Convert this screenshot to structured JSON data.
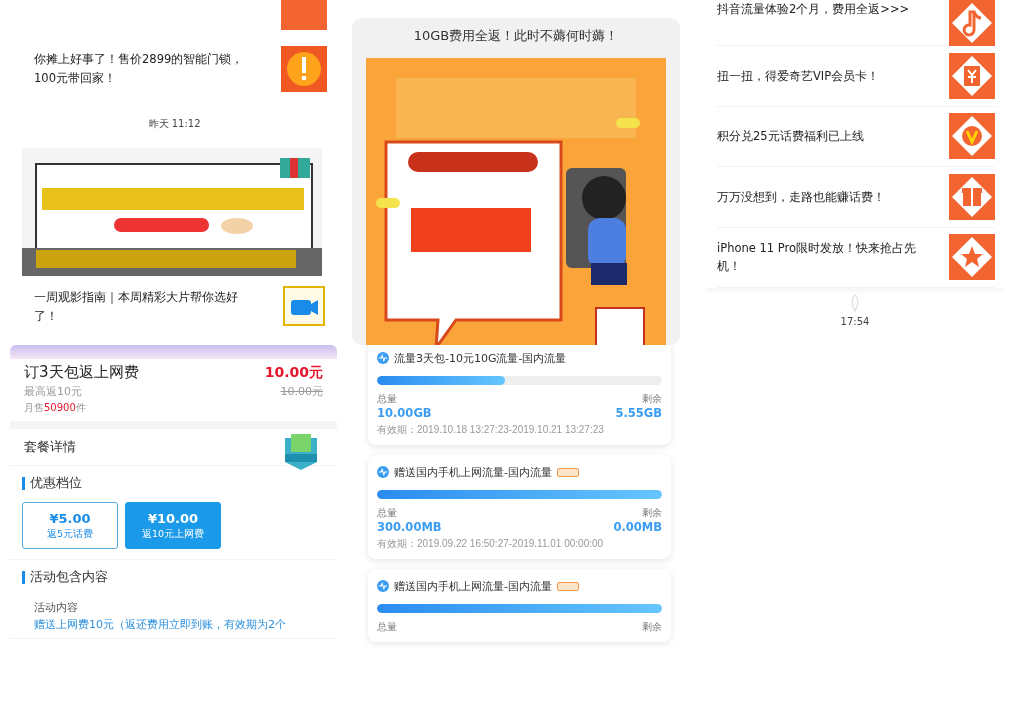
{
  "feed_left": {
    "items": [
      {
        "title": "你摊上好事了！售价2899的智能门锁，100元带回家！"
      }
    ],
    "time": "昨天 11:12",
    "items_after": [
      {
        "title": "一周观影指南｜本周精彩大片帮你选好了！"
      }
    ]
  },
  "promo": {
    "title": "10GB费用全返！此时不薅何时薅！"
  },
  "feed_right": {
    "items": [
      {
        "title": "抖音流量体验2个月，费用全返>>>"
      },
      {
        "title": "扭一扭，得爱奇艺VIP会员卡！"
      },
      {
        "title": "积分兑25元话费福利已上线"
      },
      {
        "title": "万万没想到，走路也能赚话费！"
      },
      {
        "title": "iPhone 11 Pro限时发放！快来抢占先机！"
      }
    ],
    "time": "17:54"
  },
  "product": {
    "name": "订3天包返上网费",
    "price": "10.00元",
    "max_return": "最高返10元",
    "original_price": "10.00元",
    "sales_prefix": "月售",
    "sales_count": "50900",
    "sales_suffix": "件",
    "details_label": "套餐详情",
    "tiers_label": "优惠档位",
    "tiers": [
      {
        "price": "¥5.00",
        "note": "返5元话费",
        "selected": false
      },
      {
        "price": "¥10.00",
        "note": "返10元上网费",
        "selected": true
      }
    ],
    "contents_label": "活动包含内容",
    "contents_heading": "活动内容",
    "contents_text": "赠送上网费10元（返还费用立即到账，有效期为2个"
  },
  "usage": {
    "cards": [
      {
        "title": "流量3天包-10元10G流量-国内流量",
        "tag": false,
        "level": 0.45,
        "total_label": "总量",
        "remaining_label": "剩余",
        "total": "10.00GB",
        "remaining": "5.55GB",
        "validity": "有效期：2019.10.18 13:27:23-2019.10.21 13:27:23"
      },
      {
        "title": "赠送国内手机上网流量-国内流量",
        "tag": true,
        "level": 1,
        "total_label": "总量",
        "remaining_label": "剩余",
        "total": "300.00MB",
        "remaining": "0.00MB",
        "validity": "有效期：2019.09.22 16:50:27-2019.11.01 00:00:00"
      },
      {
        "title": "赠送国内手机上网流量-国内流量",
        "tag": true,
        "level": 1,
        "total_label": "总量",
        "remaining_label": "剩余"
      }
    ]
  }
}
